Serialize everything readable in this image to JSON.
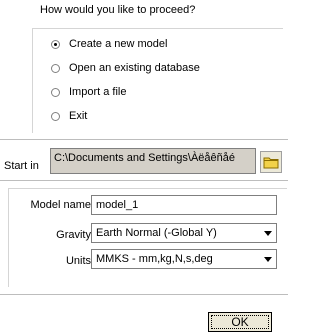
{
  "prompt": "How would you like to proceed?",
  "options": [
    {
      "label": "Create a new model",
      "checked": true
    },
    {
      "label": "Open an existing database",
      "checked": false
    },
    {
      "label": "Import a file",
      "checked": false
    },
    {
      "label": "Exit",
      "checked": false
    }
  ],
  "start_in": {
    "label": "Start in",
    "value": "C:\\Documents and Settings\\Àëåêñåé",
    "browse_icon": "folder-icon"
  },
  "model_name": {
    "label": "Model name",
    "value": "model_1"
  },
  "gravity": {
    "label": "Gravity",
    "value": "Earth Normal (-Global Y)"
  },
  "units": {
    "label": "Units",
    "value": "MMKS - mm,kg,N,s,deg"
  },
  "ok_label": "OK"
}
